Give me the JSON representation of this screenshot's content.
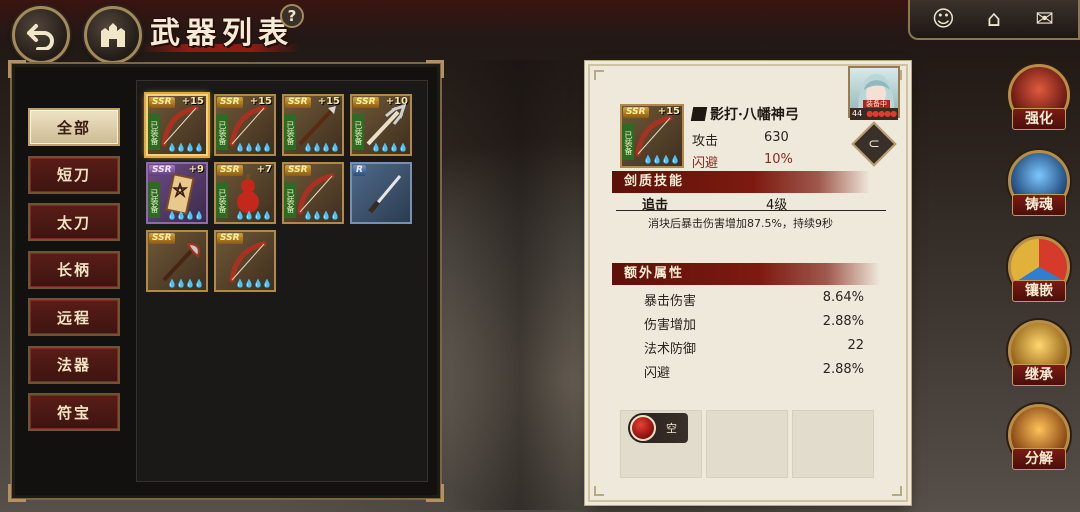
{
  "header": {
    "title": "武器列表",
    "help": "?"
  },
  "top_right": {
    "icons": [
      "character-icon",
      "home-icon",
      "mail-icon"
    ]
  },
  "categories": [
    {
      "label": "全部",
      "active": true
    },
    {
      "label": "短刀",
      "active": false
    },
    {
      "label": "太刀",
      "active": false
    },
    {
      "label": "长柄",
      "active": false
    },
    {
      "label": "远程",
      "active": false
    },
    {
      "label": "法器",
      "active": false
    },
    {
      "label": "符宝",
      "active": false
    }
  ],
  "weapons": [
    {
      "rarity": "SSR",
      "plus": "+15",
      "equipped": "已装备",
      "type": "bow",
      "selected": true
    },
    {
      "rarity": "SSR",
      "plus": "+15",
      "equipped": "已装备",
      "type": "bow"
    },
    {
      "rarity": "SSR",
      "plus": "+15",
      "equipped": "已装备",
      "type": "spear"
    },
    {
      "rarity": "SSR",
      "plus": "+10",
      "equipped": "已装备",
      "type": "trident"
    },
    {
      "rarity": "SSR",
      "plus": "+9",
      "equipped": "已装备",
      "type": "talisman",
      "tone": "purple"
    },
    {
      "rarity": "SSR",
      "plus": "+7",
      "equipped": "已装备",
      "type": "gourd"
    },
    {
      "rarity": "SSR",
      "plus": "",
      "equipped": "已装备",
      "type": "bow"
    },
    {
      "rarity": "R",
      "plus": "",
      "equipped": "",
      "type": "katana",
      "tone": "blue"
    },
    {
      "rarity": "SSR",
      "plus": "",
      "equipped": "",
      "type": "halberd"
    },
    {
      "rarity": "SSR",
      "plus": "",
      "equipped": "",
      "type": "bow"
    }
  ],
  "detail": {
    "icon": {
      "rarity": "SSR",
      "plus": "+15",
      "equipped": "已装备"
    },
    "name": "影打·八幡神弓",
    "stats": [
      {
        "label": "攻击",
        "value": "630"
      },
      {
        "label": "闪避",
        "value": "10%"
      }
    ],
    "portrait": {
      "badge": "装备中",
      "level": "44"
    },
    "skill_section": "剑质技能",
    "skill": {
      "name": "追击",
      "level": "4级",
      "desc": "消块后暴击伤害增加87.5%，持续9秒"
    },
    "extra_section": "额外属性",
    "extra": [
      {
        "label": "暴击伤害",
        "value": "8.64%"
      },
      {
        "label": "伤害增加",
        "value": "2.88%"
      },
      {
        "label": "法术防御",
        "value": "22"
      },
      {
        "label": "闪避",
        "value": "2.88%"
      }
    ],
    "gem_slot": {
      "label": "空"
    }
  },
  "actions": [
    {
      "label": "强化",
      "color": "#c23a2a"
    },
    {
      "label": "铸魂",
      "color": "#2f7fd0"
    },
    {
      "label": "镶嵌",
      "color": "#d08a2a"
    },
    {
      "label": "继承",
      "color": "#d9a63a"
    },
    {
      "label": "分解",
      "color": "#e38a2a"
    }
  ]
}
